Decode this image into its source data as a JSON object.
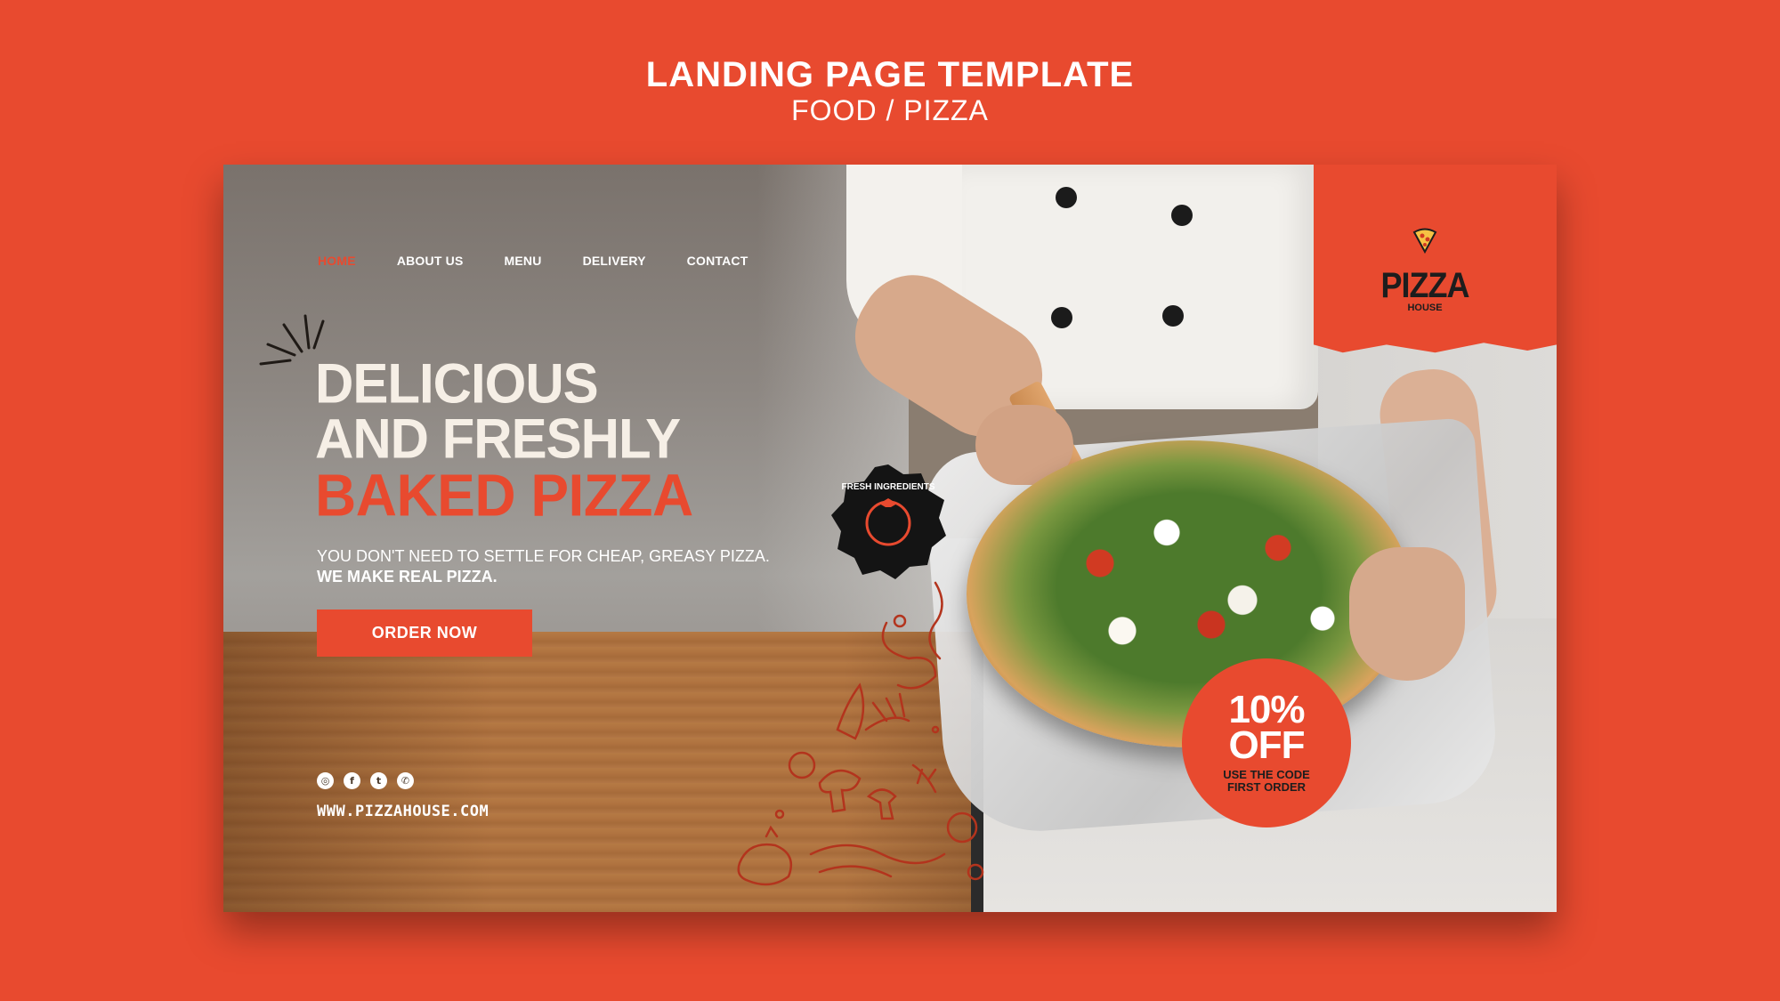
{
  "template": {
    "title": "LANDING PAGE TEMPLATE",
    "subtitle": "FOOD / PIZZA"
  },
  "nav": {
    "items": [
      {
        "label": "HOME",
        "active": true
      },
      {
        "label": "ABOUT US",
        "active": false
      },
      {
        "label": "MENU",
        "active": false
      },
      {
        "label": "DELIVERY",
        "active": false
      },
      {
        "label": "CONTACT",
        "active": false
      }
    ]
  },
  "logo": {
    "word": "PIZZA",
    "sub": "HOUSE",
    "icon": "pizza-slice-icon"
  },
  "hero": {
    "line1": "DELICIOUS",
    "line2": "AND FRESHLY",
    "line3": "BAKED PIZZA",
    "tagline": "YOU DON'T NEED TO SETTLE FOR CHEAP, GREASY PIZZA.",
    "tagline_bold": "WE MAKE REAL PIZZA.",
    "cta": "ORDER NOW"
  },
  "badge": {
    "text": "FRESH INGREDIENTS",
    "icon": "tomato-icon"
  },
  "discount": {
    "big1": "10%",
    "big2": "OFF",
    "small1": "USE THE CODE",
    "small2": "FIRST ORDER"
  },
  "social": {
    "icons": [
      "instagram-icon",
      "facebook-icon",
      "twitter-icon",
      "whatsapp-icon"
    ],
    "glyphs": [
      "◎",
      "f",
      "t",
      "✆"
    ]
  },
  "website": "WWW.PIZZAHOUSE.COM",
  "colors": {
    "accent": "#e84a2f",
    "cream": "#f6efe6",
    "dark": "#1d1d1d"
  }
}
